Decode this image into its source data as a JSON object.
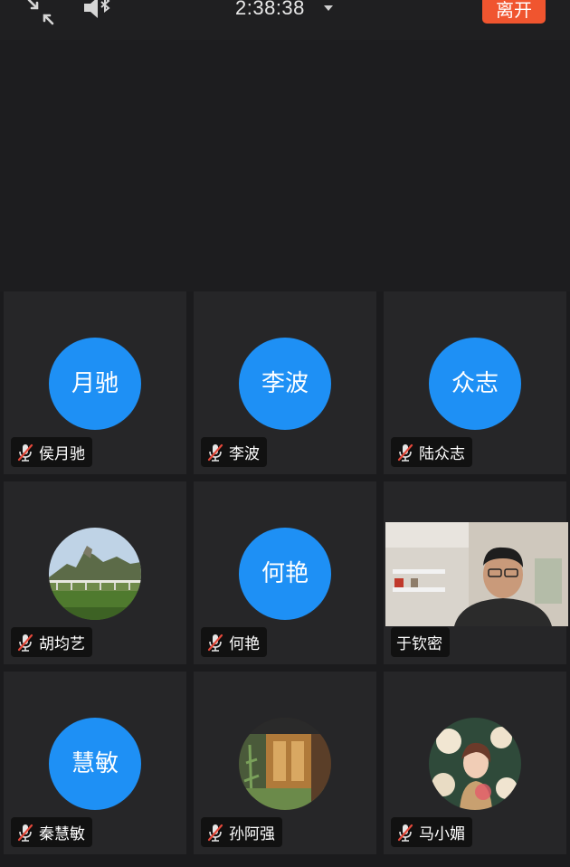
{
  "topbar": {
    "shrink_icon": "shrink-arrows-icon",
    "speaker_icon": "speaker-bluetooth-icon",
    "timer": "2:38:38",
    "leave_label": "离开",
    "accent": "#f0552f"
  },
  "participants": [
    {
      "avatar_text": "月驰",
      "name": "侯月驰",
      "muted": true
    },
    {
      "avatar_text": "李波",
      "name": "李波",
      "muted": true
    },
    {
      "avatar_text": "众志",
      "name": "陆众志",
      "muted": true
    },
    {
      "avatar_type": "photo",
      "name": "胡均艺",
      "muted": true
    },
    {
      "avatar_text": "何艳",
      "name": "何艳",
      "muted": true
    },
    {
      "avatar_type": "video",
      "name": "于钦密",
      "muted": false
    },
    {
      "avatar_text": "慧敏",
      "name": "秦慧敏",
      "muted": true
    },
    {
      "avatar_type": "photo",
      "name": "孙阿强",
      "muted": true
    },
    {
      "avatar_type": "photo",
      "name": "马小媚",
      "muted": true
    }
  ],
  "colors": {
    "avatar_blue": "#1e90f5",
    "mute_red": "#e5483a",
    "tile_bg": "#262628"
  }
}
